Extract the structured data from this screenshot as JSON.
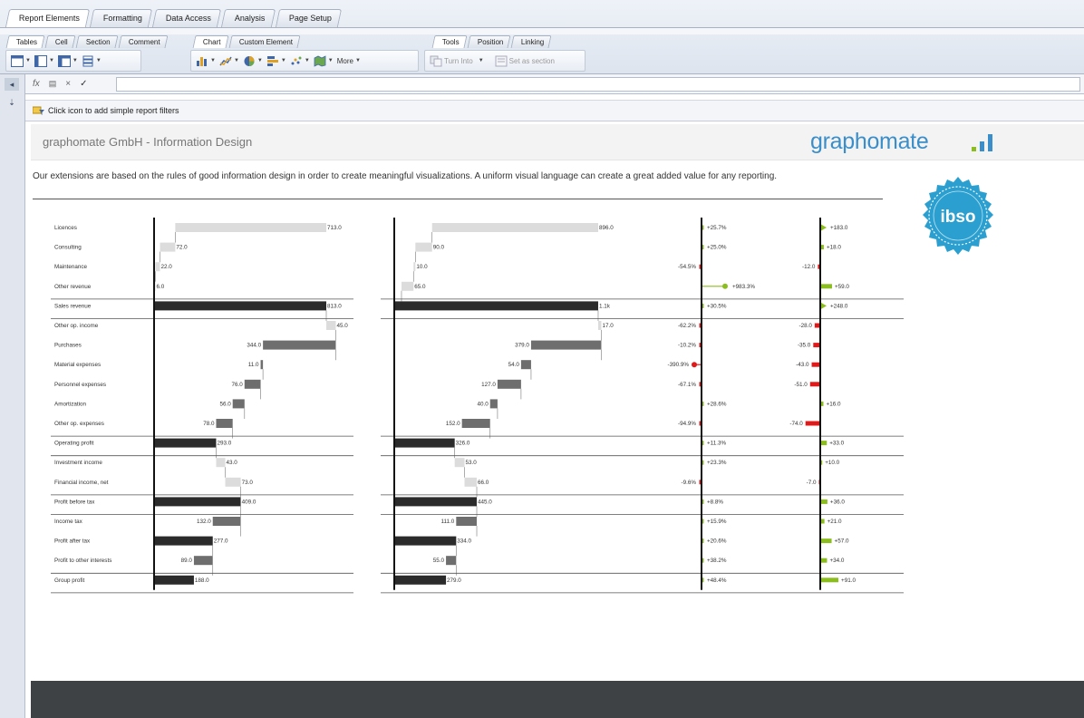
{
  "ribbon": {
    "main_tabs": [
      "Report Elements",
      "Formatting",
      "Data Access",
      "Analysis",
      "Page Setup"
    ],
    "sub_tabs_left": [
      "Tables",
      "Cell",
      "Section",
      "Comment"
    ],
    "sub_tabs_mid": [
      "Chart",
      "Custom Element"
    ],
    "sub_tabs_right": [
      "Tools",
      "Position",
      "Linking"
    ],
    "more_label": "More",
    "turn_into_label": "Turn Into",
    "set_as_section_label": "Set as section"
  },
  "formula_bar": {
    "fx": "fx",
    "cancel": "×",
    "accept": "✓"
  },
  "filter_bar": {
    "text": "Click icon to add simple report filters"
  },
  "report": {
    "title": "graphomate GmbH - Information Design",
    "brand": "graphomate",
    "intro": "Our extensions are based on the rules of good information design in order to create meaningful visualizations. A uniform visual language can create a great added value for any reporting.",
    "seal_text": "ibso"
  },
  "chart_data": {
    "type": "bar",
    "rows": [
      {
        "label": "Licences",
        "ac": "713.0",
        "py": "896.0",
        "pct": "+25.7%",
        "abs": "+183.0"
      },
      {
        "label": "Consulting",
        "ac": "72.0",
        "py": "90.0",
        "pct": "+25.0%",
        "abs": "+18.0"
      },
      {
        "label": "Maintenance",
        "ac": "22.0",
        "py": "10.0",
        "pct": "-54.5%",
        "abs": "-12.0"
      },
      {
        "label": "Other revenue",
        "ac": "6.0",
        "py": "65.0",
        "pct": "+983.3%",
        "abs": "+59.0"
      },
      {
        "label": "Sales revenue",
        "ac": "813.0",
        "py": "1.1k",
        "pct": "+30.5%",
        "abs": "+248.0"
      },
      {
        "label": "Other op. income",
        "ac": "45.0",
        "py": "17.0",
        "pct": "-62.2%",
        "abs": "-28.0"
      },
      {
        "label": "Purchases",
        "ac": "344.0",
        "py": "379.0",
        "pct": "-10.2%",
        "abs": "-35.0"
      },
      {
        "label": "Material expenses",
        "ac": "11.0",
        "py": "54.0",
        "pct": "-390.9%",
        "abs": "-43.0"
      },
      {
        "label": "Personnel expenses",
        "ac": "76.0",
        "py": "127.0",
        "pct": "-67.1%",
        "abs": "-51.0"
      },
      {
        "label": "Amortization",
        "ac": "56.0",
        "py": "40.0",
        "pct": "+28.6%",
        "abs": "+16.0"
      },
      {
        "label": "Other op. expenses",
        "ac": "78.0",
        "py": "152.0",
        "pct": "-94.9%",
        "abs": "-74.0"
      },
      {
        "label": "Operating profit",
        "ac": "293.0",
        "py": "326.0",
        "pct": "+11.3%",
        "abs": "+33.0"
      },
      {
        "label": "Investment income",
        "ac": "43.0",
        "py": "53.0",
        "pct": "+23.3%",
        "abs": "+10.0"
      },
      {
        "label": "Financial income, net",
        "ac": "73.0",
        "py": "66.0",
        "pct": "-9.6%",
        "abs": "-7.0"
      },
      {
        "label": "Profit before tax",
        "ac": "409.0",
        "py": "445.0",
        "pct": "+8.8%",
        "abs": "+36.0"
      },
      {
        "label": "Income tax",
        "ac": "132.0",
        "py": "111.0",
        "pct": "+15.9%",
        "abs": "+21.0"
      },
      {
        "label": "Profit after tax",
        "ac": "277.0",
        "py": "334.0",
        "pct": "+20.6%",
        "abs": "+57.0"
      },
      {
        "label": "Profit to other interests",
        "ac": "89.0",
        "py": "55.0",
        "pct": "+38.2%",
        "abs": "+34.0"
      },
      {
        "label": "Group profit",
        "ac": "188.0",
        "py": "279.0",
        "pct": "+48.4%",
        "abs": "+91.0"
      }
    ],
    "colors": {
      "revenue_bar": "#dcdcdc",
      "cost_bar": "#6e6e6e",
      "total_bar": "#2b2b2b",
      "positive": "#8cbd1e",
      "negative": "#e01a1a",
      "brand": "#3a8ec9"
    }
  }
}
